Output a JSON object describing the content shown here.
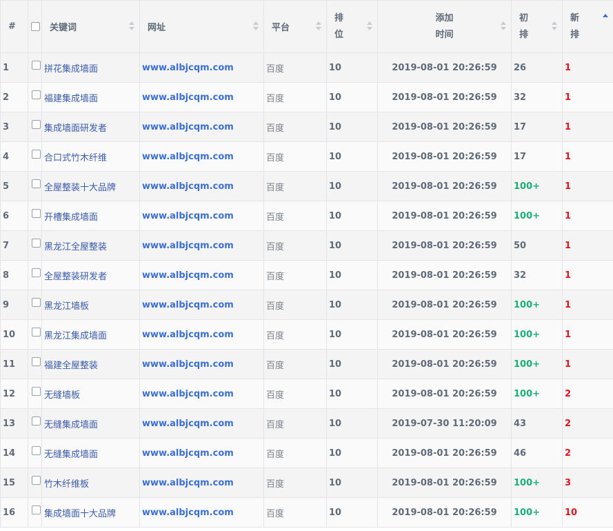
{
  "headers": {
    "index": "#",
    "keyword": "关键词",
    "url": "网址",
    "platform": "平台",
    "rank_1": "排",
    "rank_2": "位",
    "added_1": "添加",
    "added_2": "时间",
    "initial_1": "初",
    "initial_2": "排",
    "new_1": "新",
    "new_2": "排"
  },
  "sort": {
    "active_column": "new_rank",
    "direction": "ascending"
  },
  "colors": {
    "link": "#3b6fd6",
    "keyword": "#3b5ba8",
    "green": "#19b078",
    "red": "#e4141c"
  },
  "rows": [
    {
      "index": "1",
      "keyword": "拼花集成墙面",
      "url": "www.albjcqm.com",
      "platform": "百度",
      "rank": "10",
      "added": "2019-08-01 20:26:59",
      "initial": "26",
      "new_rank": "1"
    },
    {
      "index": "2",
      "keyword": "福建集成墙面",
      "url": "www.albjcqm.com",
      "platform": "百度",
      "rank": "10",
      "added": "2019-08-01 20:26:59",
      "initial": "32",
      "new_rank": "1"
    },
    {
      "index": "3",
      "keyword": "集成墙面研发者",
      "url": "www.albjcqm.com",
      "platform": "百度",
      "rank": "10",
      "added": "2019-08-01 20:26:59",
      "initial": "17",
      "new_rank": "1"
    },
    {
      "index": "4",
      "keyword": "合口式竹木纤维",
      "url": "www.albjcqm.com",
      "platform": "百度",
      "rank": "10",
      "added": "2019-08-01 20:26:59",
      "initial": "17",
      "new_rank": "1"
    },
    {
      "index": "5",
      "keyword": "全屋整装十大品牌",
      "url": "www.albjcqm.com",
      "platform": "百度",
      "rank": "10",
      "added": "2019-08-01 20:26:59",
      "initial": "100+",
      "new_rank": "1"
    },
    {
      "index": "6",
      "keyword": "开槽集成墙面",
      "url": "www.albjcqm.com",
      "platform": "百度",
      "rank": "10",
      "added": "2019-08-01 20:26:59",
      "initial": "100+",
      "new_rank": "1"
    },
    {
      "index": "7",
      "keyword": "黑龙江全屋整装",
      "url": "www.albjcqm.com",
      "platform": "百度",
      "rank": "10",
      "added": "2019-08-01 20:26:59",
      "initial": "50",
      "new_rank": "1"
    },
    {
      "index": "8",
      "keyword": "全屋整装研发者",
      "url": "www.albjcqm.com",
      "platform": "百度",
      "rank": "10",
      "added": "2019-08-01 20:26:59",
      "initial": "32",
      "new_rank": "1"
    },
    {
      "index": "9",
      "keyword": "黑龙江墙板",
      "url": "www.albjcqm.com",
      "platform": "百度",
      "rank": "10",
      "added": "2019-08-01 20:26:59",
      "initial": "100+",
      "new_rank": "1"
    },
    {
      "index": "10",
      "keyword": "黑龙江集成墙面",
      "url": "www.albjcqm.com",
      "platform": "百度",
      "rank": "10",
      "added": "2019-08-01 20:26:59",
      "initial": "100+",
      "new_rank": "1"
    },
    {
      "index": "11",
      "keyword": "福建全屋整装",
      "url": "www.albjcqm.com",
      "platform": "百度",
      "rank": "10",
      "added": "2019-08-01 20:26:59",
      "initial": "100+",
      "new_rank": "1"
    },
    {
      "index": "12",
      "keyword": "无缝墙板",
      "url": "www.albjcqm.com",
      "platform": "百度",
      "rank": "10",
      "added": "2019-08-01 20:26:59",
      "initial": "100+",
      "new_rank": "2"
    },
    {
      "index": "13",
      "keyword": "无缝集成墙面",
      "url": "www.albjcqm.com",
      "platform": "百度",
      "rank": "10",
      "added": "2019-07-30 11:20:09",
      "initial": "43",
      "new_rank": "2"
    },
    {
      "index": "14",
      "keyword": "无缝集成墙面",
      "url": "www.albjcqm.com",
      "platform": "百度",
      "rank": "10",
      "added": "2019-08-01 20:26:59",
      "initial": "46",
      "new_rank": "2"
    },
    {
      "index": "15",
      "keyword": "竹木纤维板",
      "url": "www.albjcqm.com",
      "platform": "百度",
      "rank": "10",
      "added": "2019-08-01 20:26:59",
      "initial": "100+",
      "new_rank": "3"
    },
    {
      "index": "16",
      "keyword": "集成墙面十大品牌",
      "url": "www.albjcqm.com",
      "platform": "百度",
      "rank": "10",
      "added": "2019-08-01 20:26:59",
      "initial": "100+",
      "new_rank": "10"
    }
  ]
}
